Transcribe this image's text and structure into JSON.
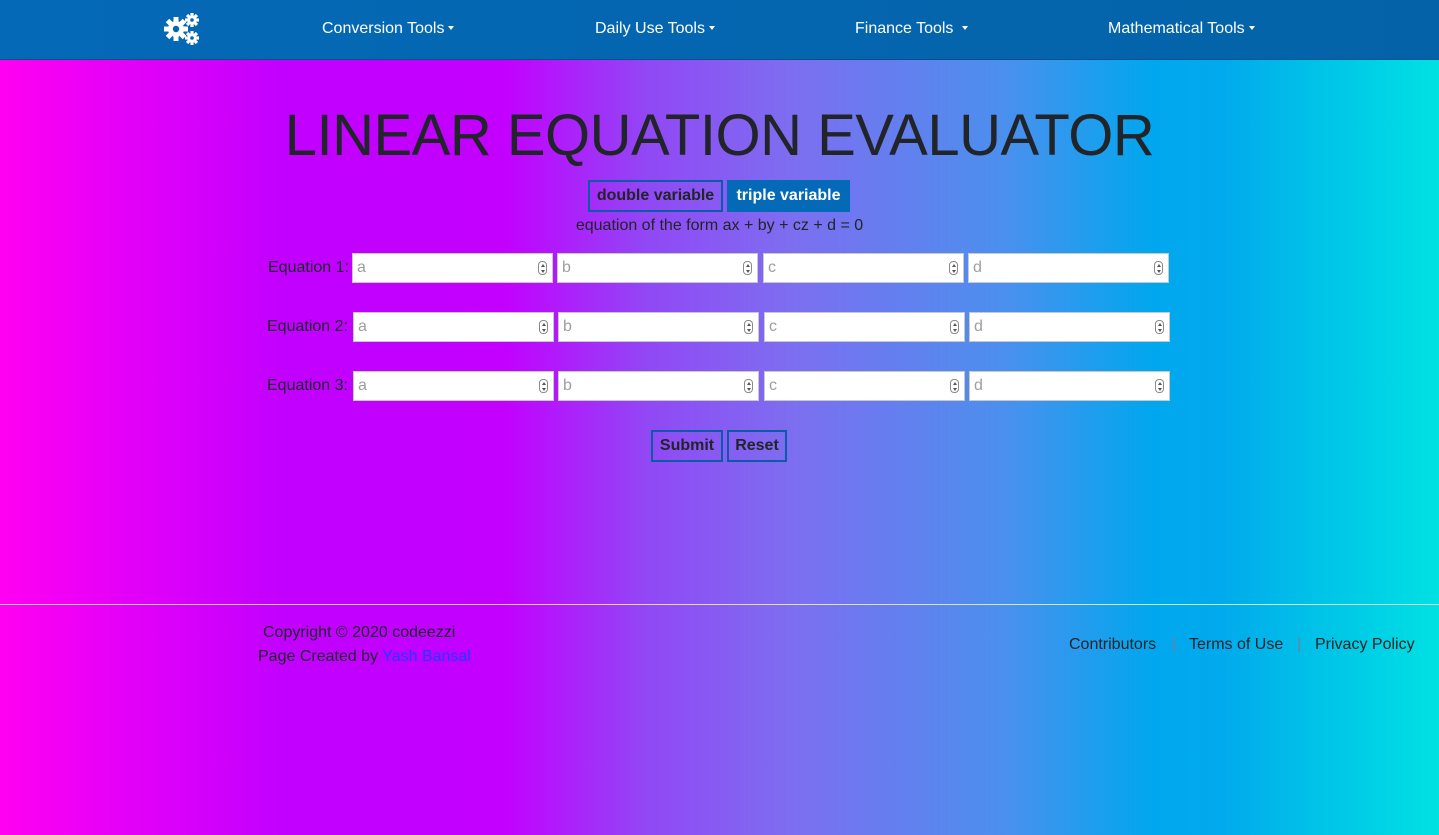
{
  "nav": {
    "brand_icon": "gears-icon",
    "items": [
      {
        "label": "Conversion Tools"
      },
      {
        "label": "Daily Use Tools"
      },
      {
        "label": "Finance Tools"
      },
      {
        "label": "Mathematical Tools"
      }
    ]
  },
  "page": {
    "title": "LINEAR EQUATION EVALUATOR",
    "tabs": {
      "double": "double variable",
      "triple": "triple variable",
      "active": "triple variable"
    },
    "form_hint": "equation of the form ax + by + cz + d = 0"
  },
  "equations": [
    {
      "label": "Equation 1:",
      "placeholders": [
        "a",
        "b",
        "c",
        "d"
      ]
    },
    {
      "label": "Equation 2:",
      "placeholders": [
        "a",
        "b",
        "c",
        "d"
      ]
    },
    {
      "label": "Equation 3:",
      "placeholders": [
        "a",
        "b",
        "c",
        "d"
      ]
    }
  ],
  "buttons": {
    "submit": "Submit",
    "reset": "Reset"
  },
  "footer": {
    "copyright": "Copyright © 2020 codeezzi",
    "created_prefix": "Page Created by ",
    "author": "Yash Bansal",
    "links": [
      "Contributors",
      "Terms of Use",
      "Privacy Policy"
    ],
    "separator": "|"
  },
  "colors": {
    "navbar": "#0469b7",
    "accent_border": "#0c5aa8",
    "author_link": "#1b3cff"
  }
}
